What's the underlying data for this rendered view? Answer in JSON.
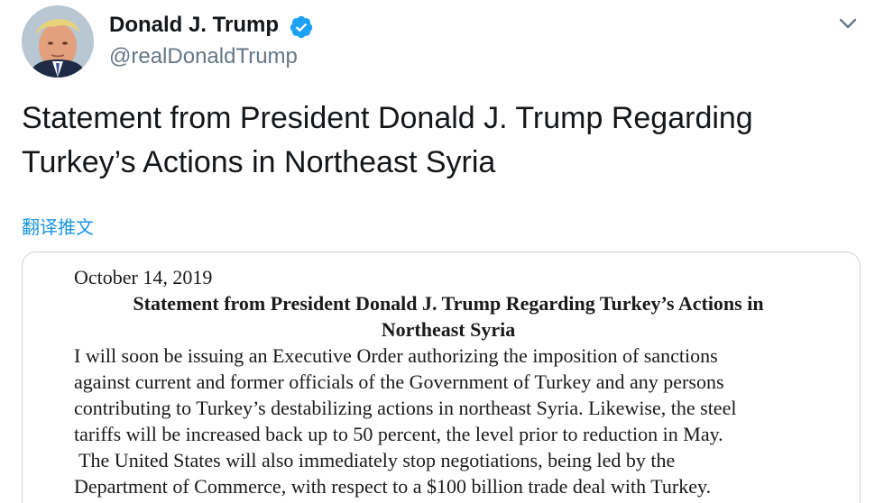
{
  "tweet": {
    "author": {
      "display_name": "Donald J. Trump",
      "handle": "@realDonaldTrump",
      "verified": true,
      "verified_icon": "verified-badge-icon",
      "avatar_icon": "avatar"
    },
    "more_icon": "chevron-down-icon",
    "text_lines": [
      "Statement from President Donald J. Trump Regarding",
      "Turkey’s Actions in Northeast Syria"
    ],
    "translate_label": "翻译推文",
    "colors": {
      "link": "#1b95e0",
      "verified": "#1da1f2",
      "secondary_text": "#657786",
      "border": "#ccd6dd"
    }
  },
  "document": {
    "date": "October 14, 2019",
    "title_lines": [
      "Statement from President Donald J. Trump Regarding Turkey’s Actions in",
      "Northeast Syria"
    ],
    "body_lines": [
      "I will soon be issuing an Executive Order authorizing the imposition of sanctions",
      "against current and former officials of the Government of Turkey and any persons",
      "contributing to Turkey’s destabilizing actions in northeast Syria. Likewise, the steel",
      "tariffs will be increased back up to 50 percent, the level prior to reduction in May.",
      " The United States will also immediately stop negotiations, being led by the",
      "Department of Commerce, with respect to a $100 billion trade deal with Turkey."
    ]
  }
}
